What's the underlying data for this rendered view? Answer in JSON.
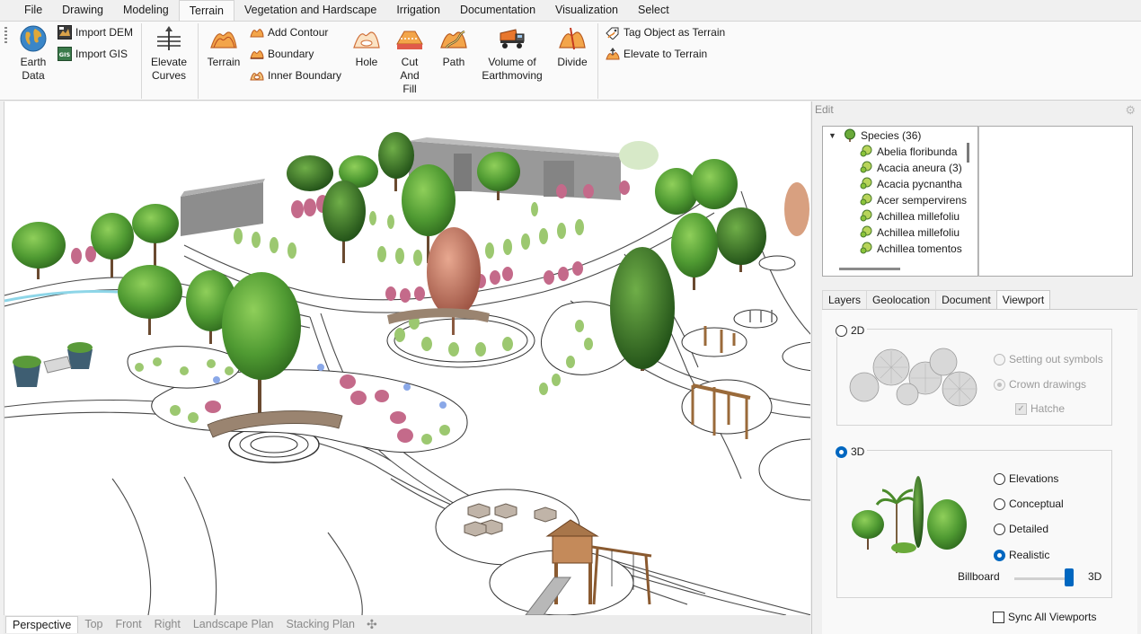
{
  "menu": {
    "tabs": [
      {
        "label": "File",
        "active": false
      },
      {
        "label": "Drawing",
        "active": false
      },
      {
        "label": "Modeling",
        "active": false
      },
      {
        "label": "Terrain",
        "active": true
      },
      {
        "label": "Vegetation and Hardscape",
        "active": false
      },
      {
        "label": "Irrigation",
        "active": false
      },
      {
        "label": "Documentation",
        "active": false
      },
      {
        "label": "Visualization",
        "active": false
      },
      {
        "label": "Select",
        "active": false
      }
    ]
  },
  "ribbon": {
    "earth_data": {
      "line1": "Earth",
      "line2": "Data",
      "icon": "globe-icon"
    },
    "import_dem": {
      "label": "Import DEM",
      "icon": "dem-icon"
    },
    "import_gis": {
      "label": "Import GIS",
      "icon": "gis-icon",
      "badge": "GIS"
    },
    "elevate_curves": {
      "line1": "Elevate",
      "line2": "Curves",
      "icon": "elevate-curves-icon"
    },
    "terrain": {
      "label": "Terrain",
      "icon": "terrain-icon"
    },
    "add_contour": {
      "label": "Add Contour",
      "icon": "contour-icon"
    },
    "boundary": {
      "label": "Boundary",
      "icon": "boundary-icon"
    },
    "inner_boundary": {
      "label": "Inner Boundary",
      "icon": "inner-boundary-icon"
    },
    "hole": {
      "label": "Hole",
      "icon": "hole-icon"
    },
    "cut_and_fill": {
      "line1": "Cut",
      "line2": "And",
      "line3": "Fill",
      "icon": "cut-fill-icon"
    },
    "path": {
      "label": "Path",
      "icon": "path-icon"
    },
    "volume": {
      "line1": "Volume of",
      "line2": "Earthmoving",
      "icon": "truck-icon"
    },
    "divide": {
      "label": "Divide",
      "icon": "divide-icon"
    },
    "tag_object": {
      "label": "Tag Object as Terrain",
      "icon": "tag-icon"
    },
    "elevate_to_terrain": {
      "label": "Elevate to Terrain",
      "icon": "elevate-icon"
    }
  },
  "view_tabs": [
    {
      "label": "Perspective",
      "active": true
    },
    {
      "label": "Top",
      "active": false
    },
    {
      "label": "Front",
      "active": false
    },
    {
      "label": "Right",
      "active": false
    },
    {
      "label": "Landscape Plan",
      "active": false
    },
    {
      "label": "Stacking Plan",
      "active": false
    }
  ],
  "view_tabs_add": "✣",
  "panel": {
    "title": "Edit",
    "gear": "⚙",
    "tree": {
      "root": "Species (36)",
      "items": [
        "Abelia floribunda",
        "Acacia aneura (3)",
        "Acacia pycnantha",
        "Acer sempervirens",
        "Achillea millefoliu",
        "Achillea millefoliu",
        "Achillea tomentos"
      ]
    },
    "tabs": [
      {
        "label": "Layers",
        "active": false
      },
      {
        "label": "Geolocation",
        "active": false
      },
      {
        "label": "Document",
        "active": false
      },
      {
        "label": "Viewport",
        "active": true
      }
    ],
    "viewport": {
      "mode_2d": {
        "label": "2D",
        "selected": false
      },
      "setting_out": {
        "label": "Setting out symbols",
        "selected": false
      },
      "crown": {
        "label": "Crown drawings",
        "selected": true
      },
      "hatche": {
        "label": "Hatche",
        "checked": true
      },
      "mode_3d": {
        "label": "3D",
        "selected": true
      },
      "elevations": {
        "label": "Elevations",
        "selected": false
      },
      "conceptual": {
        "label": "Conceptual",
        "selected": false
      },
      "detailed": {
        "label": "Detailed",
        "selected": false
      },
      "realistic": {
        "label": "Realistic",
        "selected": true
      },
      "slider": {
        "left_label": "Billboard",
        "right_label": "3D",
        "value": 1.0
      },
      "sync": {
        "label": "Sync All Viewports",
        "checked": false
      }
    }
  },
  "colors": {
    "accent": "#0067c0",
    "ribbon_bg": "#fafafa",
    "panel_bg": "#f0f0f0"
  }
}
